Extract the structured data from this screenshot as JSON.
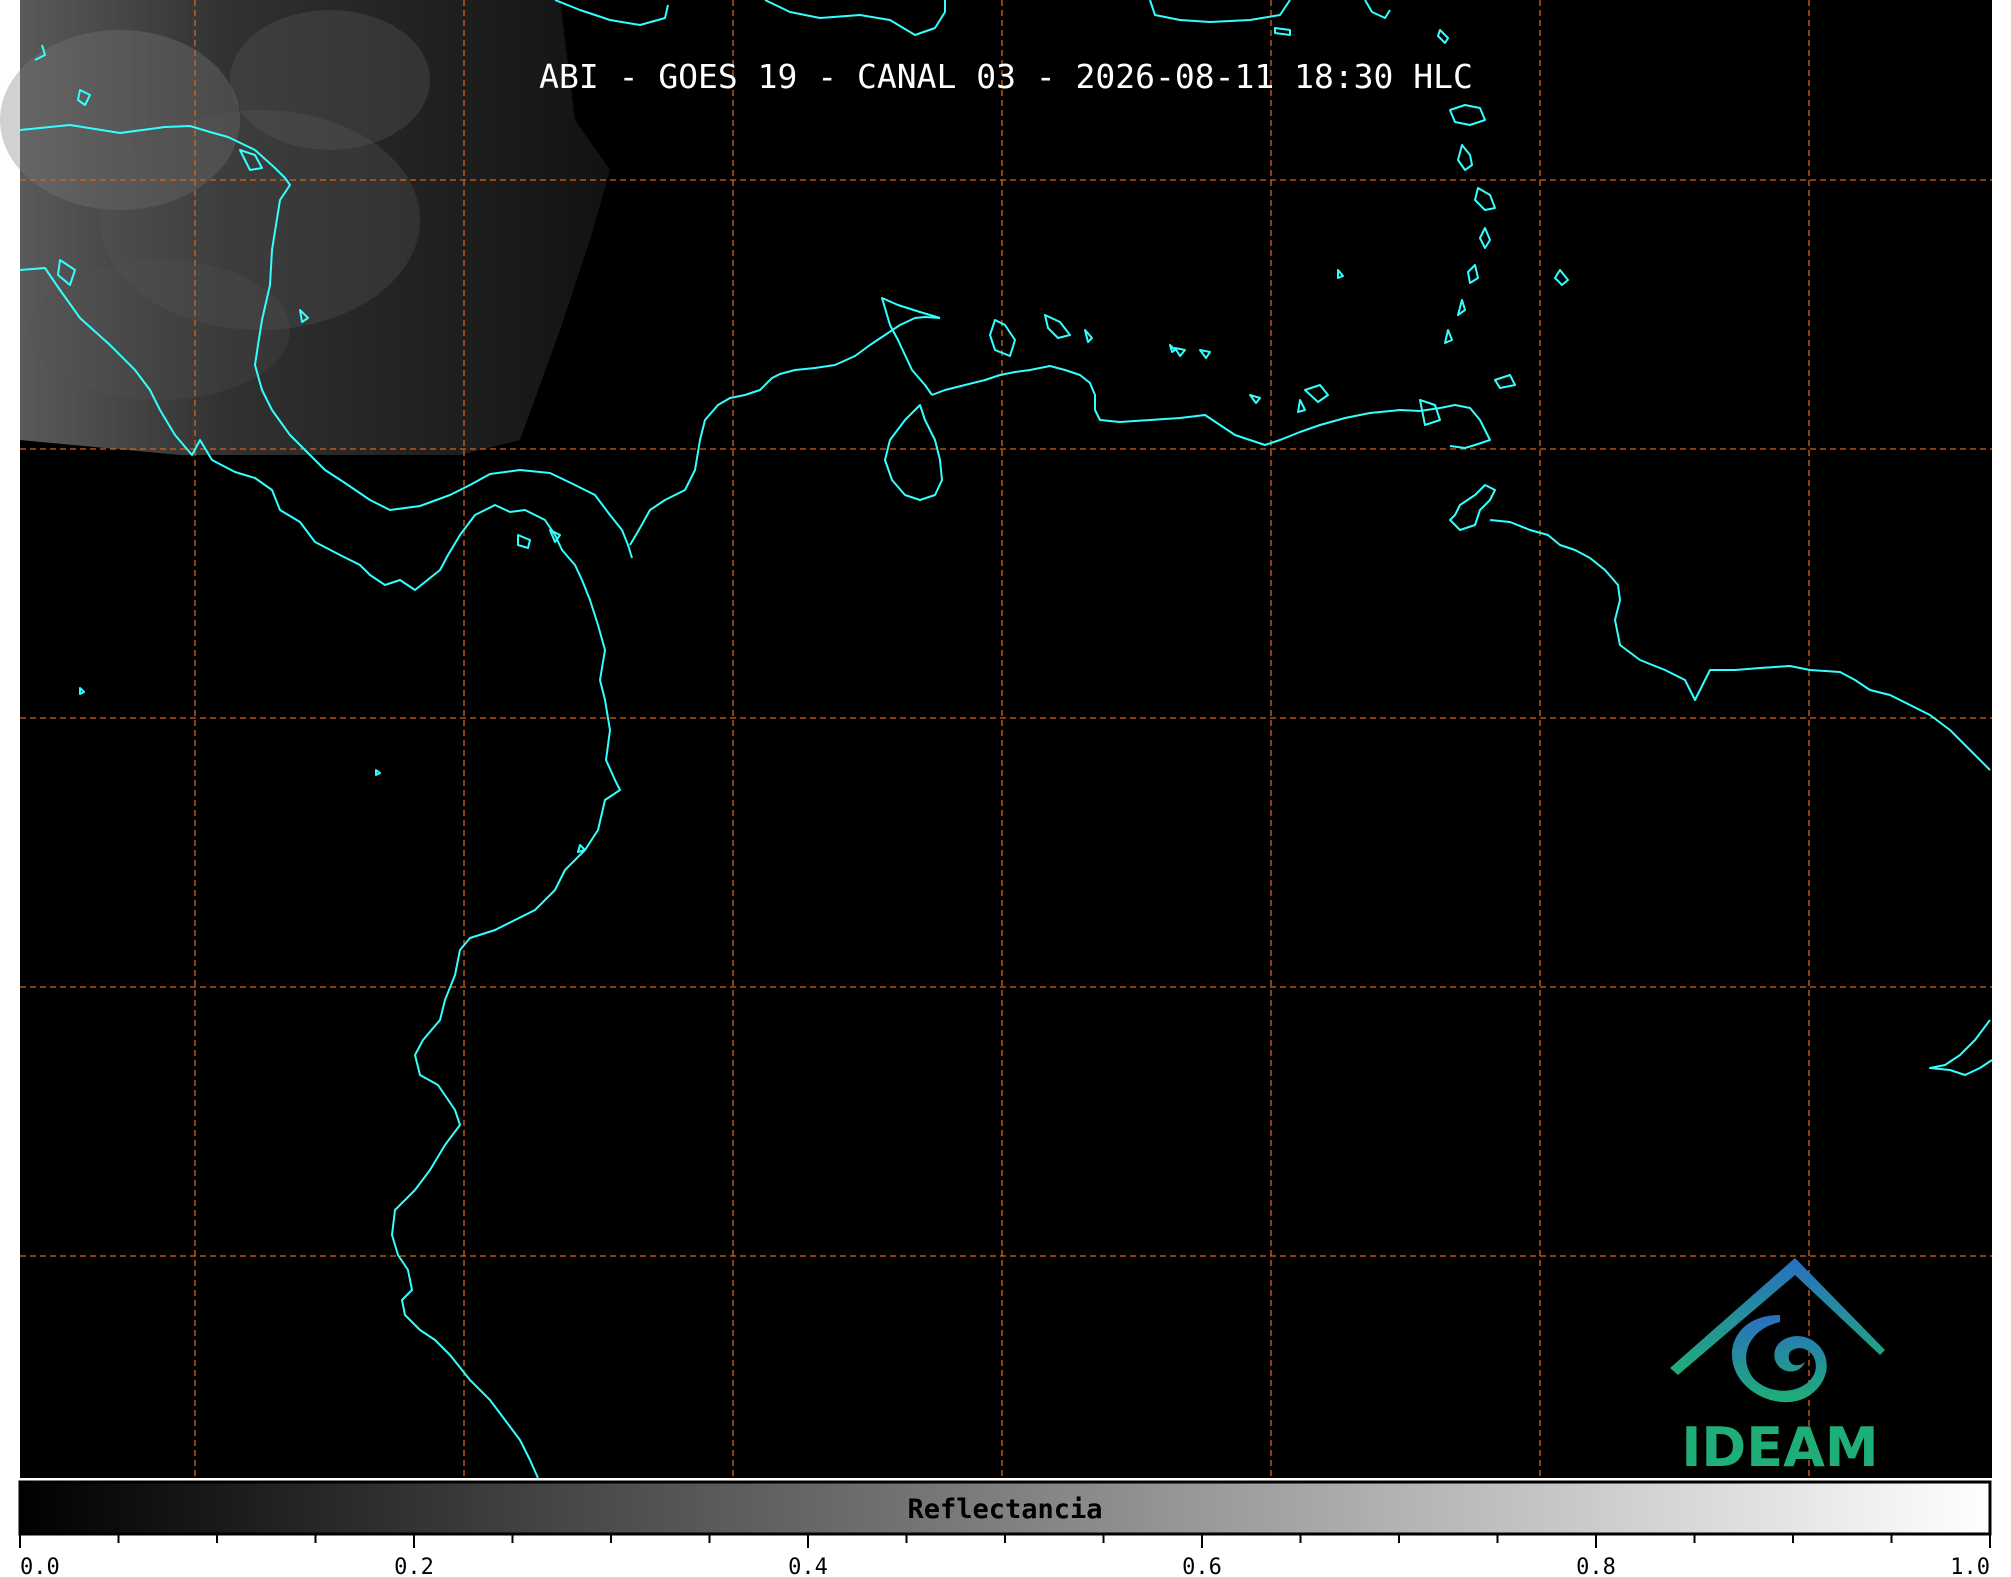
{
  "title": "ABI - GOES 19 - CANAL 03 - 2026-08-11 18:30 HLC",
  "colorbar": {
    "label": "Reflectancia",
    "ticks": [
      "0.0",
      "0.2",
      "0.4",
      "0.6",
      "0.8",
      "1.0"
    ],
    "range": [
      0.0,
      1.0
    ],
    "colormap": [
      "#000000",
      "#ffffff"
    ]
  },
  "logo": {
    "text": "IDEAM",
    "color": "#1fae78",
    "accent": "#2a7fbf"
  },
  "colors": {
    "background": "#000000",
    "coastline": "#33ffff",
    "gridlines": "#d4641e"
  }
}
